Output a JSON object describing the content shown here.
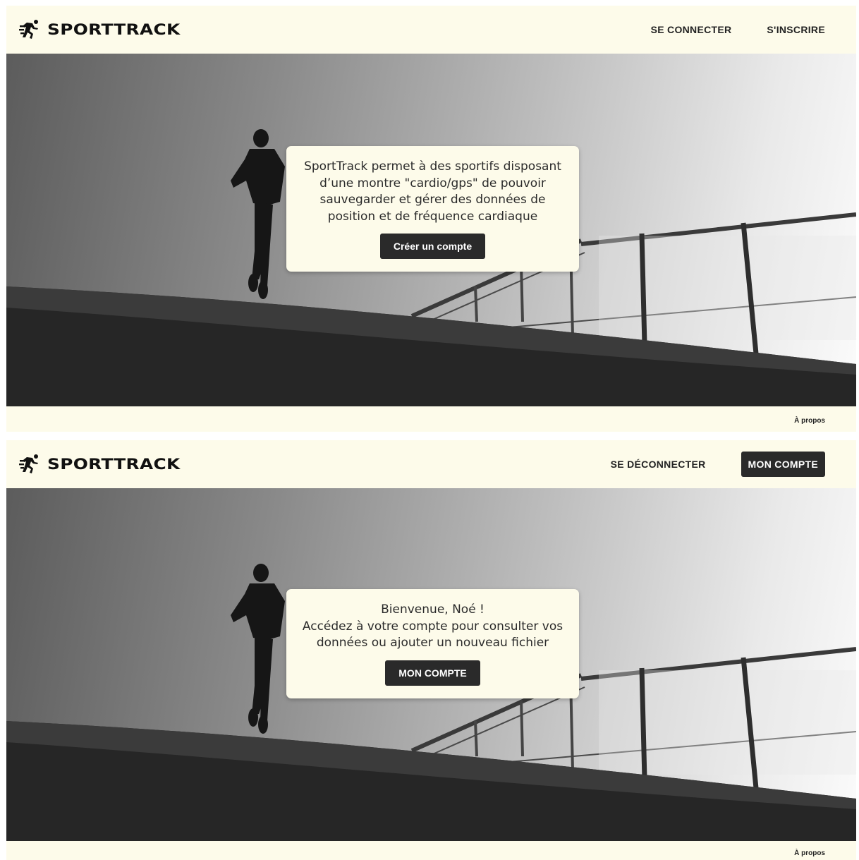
{
  "screen_1": {
    "brand": {
      "icon": "runner-icon",
      "name": "SPORTTRACK"
    },
    "nav": {
      "login_label": "SE CONNECTER",
      "signup_label": "S'INSCRIRE"
    },
    "hero_card": {
      "text": "SportTrack permet à des sportifs disposant d’une montre \"cardio/gps\" de pouvoir sauvegarder et gérer des données de position et de fréquence cardiaque",
      "button_label": "Créer un compte"
    },
    "footer": {
      "about_label": "À propos"
    }
  },
  "screen_2": {
    "brand": {
      "icon": "runner-icon",
      "name": "SPORTTRACK"
    },
    "nav": {
      "logout_label": "SE DÉCONNECTER",
      "account_label": "MON COMPTE"
    },
    "hero_card": {
      "greeting": "Bienvenue, Noé !",
      "text": "Accédez à votre compte pour consulter vos données ou ajouter un nouveau fichier",
      "button_label": "MON COMPTE"
    },
    "footer": {
      "about_label": "À propos"
    }
  },
  "colors": {
    "background": "#fdfbea",
    "button": "#2a2a2a",
    "text": "#222222"
  }
}
